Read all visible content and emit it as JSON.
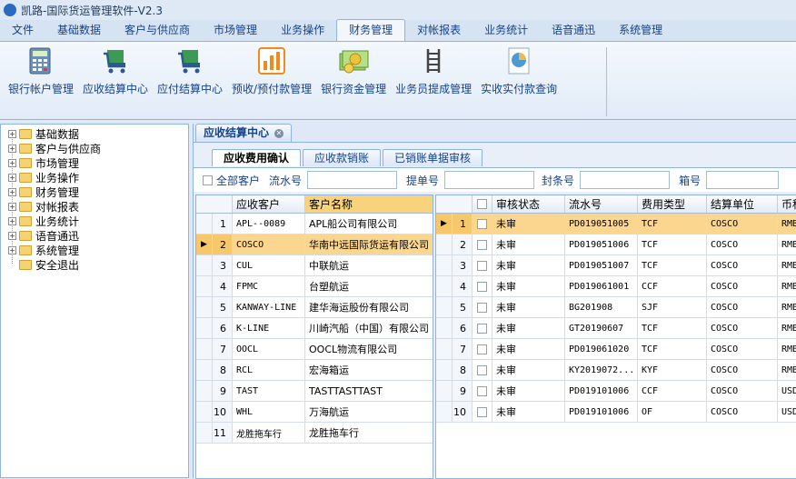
{
  "window": {
    "title": "凯路-国际货运管理软件-V2.3"
  },
  "menu_tabs": [
    "文件",
    "基础数据",
    "客户与供应商",
    "市场管理",
    "业务操作",
    "财务管理",
    "对帐报表",
    "业务统计",
    "语音通迅",
    "系统管理"
  ],
  "ribbon": [
    "银行帐户管理",
    "应收结算中心",
    "应付结算中心",
    "预收/预付款管理",
    "银行资金管理",
    "业务员提成管理",
    "实收实付款查询"
  ],
  "tree": [
    "基础数据",
    "客户与供应商",
    "市场管理",
    "业务操作",
    "财务管理",
    "对帐报表",
    "业务统计",
    "语音通迅",
    "系统管理",
    "安全退出"
  ],
  "doc_tab": "应收结算中心",
  "sub_tabs": [
    "应收费用确认",
    "应收款销账",
    "已销账单据审核"
  ],
  "filter": {
    "all_customers": "全部客户",
    "serial": "流水号",
    "bl": "提单号",
    "seal": "封条号",
    "box": "箱号"
  },
  "left_grid": {
    "headers": [
      "应收客户",
      "客户名称"
    ],
    "rows": [
      [
        "1",
        "APL--0089",
        "APL船公司有限公司"
      ],
      [
        "2",
        "COSCO",
        "华南中远国际货运有限公司"
      ],
      [
        "3",
        "CUL",
        "中联航运"
      ],
      [
        "4",
        "FPMC",
        "台塑航运"
      ],
      [
        "5",
        "KANWAY-LINE",
        "建华海运股份有限公司"
      ],
      [
        "6",
        "K-LINE",
        "川崎汽船（中国）有限公司"
      ],
      [
        "7",
        "OOCL",
        "OOCL物流有限公司"
      ],
      [
        "8",
        "RCL",
        "宏海箱运"
      ],
      [
        "9",
        "TAST",
        "TASTTASTTAST"
      ],
      [
        "10",
        "WHL",
        "万海航运"
      ],
      [
        "11",
        "龙胜拖车行",
        "龙胜拖车行"
      ]
    ]
  },
  "right_grid": {
    "headers": [
      "审核状态",
      "流水号",
      "费用类型",
      "结算单位",
      "币种"
    ],
    "rows": [
      [
        "1",
        "未审",
        "PD019051005",
        "TCF",
        "COSCO",
        "RMB"
      ],
      [
        "2",
        "未审",
        "PD019051006",
        "TCF",
        "COSCO",
        "RMB"
      ],
      [
        "3",
        "未审",
        "PD019051007",
        "TCF",
        "COSCO",
        "RMB"
      ],
      [
        "4",
        "未审",
        "PD019061001",
        "CCF",
        "COSCO",
        "RMB"
      ],
      [
        "5",
        "未审",
        "BG201908",
        "SJF",
        "COSCO",
        "RMB"
      ],
      [
        "6",
        "未审",
        "GT20190607",
        "TCF",
        "COSCO",
        "RMB"
      ],
      [
        "7",
        "未审",
        "PD019061020",
        "TCF",
        "COSCO",
        "RMB"
      ],
      [
        "8",
        "未审",
        "KY2019072...",
        "KYF",
        "COSCO",
        "RMB"
      ],
      [
        "9",
        "未审",
        "PD019101006",
        "CCF",
        "COSCO",
        "USD"
      ],
      [
        "10",
        "未审",
        "PD019101006",
        "OF",
        "COSCO",
        "USD"
      ]
    ]
  }
}
